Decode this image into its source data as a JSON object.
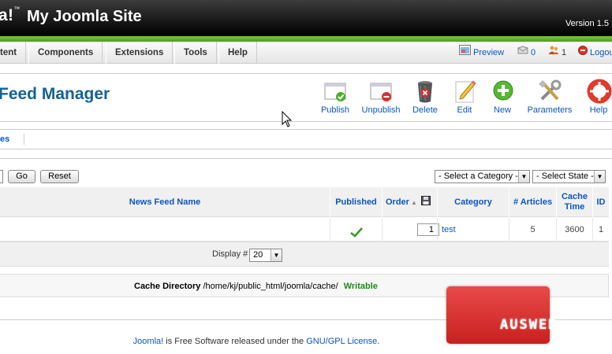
{
  "header": {
    "logo_text": "a!",
    "logo_tm": "™",
    "site_title": "My Joomla Site",
    "version": "Version 1.5"
  },
  "menu": {
    "items": [
      "tent",
      "Components",
      "Extensions",
      "Tools",
      "Help"
    ]
  },
  "status": {
    "preview": "Preview",
    "messages": "0",
    "users": "1",
    "logout": "Logou"
  },
  "toolbar": {
    "title": "Feed Manager",
    "buttons": [
      "Publish",
      "Unpublish",
      "Delete",
      "Edit",
      "New",
      "Parameters",
      "Help"
    ]
  },
  "submenu": {
    "item": "es"
  },
  "filters": {
    "go": "Go",
    "reset": "Reset",
    "category_select": "- Select a Category -",
    "state_select": "- Select State -"
  },
  "table": {
    "headers": {
      "name": "News Feed Name",
      "published": "Published",
      "order": "Order",
      "category": "Category",
      "articles": "# Articles",
      "cache_time": "Cache Time",
      "id": "ID"
    },
    "row": {
      "order": "1",
      "category": "test",
      "articles": "5",
      "cache_time": "3600",
      "id": "1",
      "published": true
    },
    "display_label": "Display #",
    "display_value": "20"
  },
  "cache": {
    "label": "Cache Directory",
    "path": "/home/kj/public_html/joomla/cache/",
    "status": "Writable",
    "status_color": "#1a8c1a"
  },
  "footer": {
    "link1": "Joomla!",
    "text": " is Free Software released under the ",
    "link2": "GNU/GPL License",
    "end": "."
  },
  "watermark": {
    "text": "AUSWEB"
  },
  "colors": {
    "link": "#0b55c4",
    "title": "#146295",
    "green_bar": "#6cbf3a"
  }
}
